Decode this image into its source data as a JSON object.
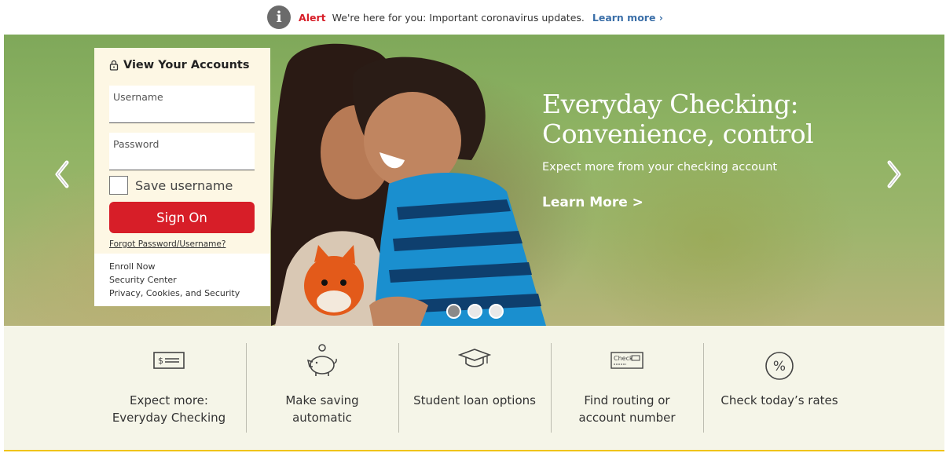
{
  "alert": {
    "icon": "info-icon",
    "label": "Alert",
    "text": "We're here for you: Important coronavirus updates.",
    "link": "Learn more"
  },
  "login": {
    "title": "View Your Accounts",
    "username_placeholder": "Username",
    "password_placeholder": "Password",
    "save_username": "Save username",
    "sign_on": "Sign On",
    "forgot": "Forgot Password/Username?",
    "links": [
      "Enroll Now",
      "Security Center",
      "Privacy, Cookies, and Security"
    ]
  },
  "hero": {
    "title_line1": "Everyday Checking:",
    "title_line2": "Convenience, control",
    "subtitle": "Expect more from your checking account",
    "cta": "Learn More >",
    "slides": {
      "count": 3,
      "active": 1
    }
  },
  "features": [
    {
      "icon": "check-bill-icon",
      "line1": "Expect more:",
      "line2": "Everyday Checking"
    },
    {
      "icon": "piggy-bank-icon",
      "line1": "Make saving",
      "line2": "automatic"
    },
    {
      "icon": "graduation-cap-icon",
      "line1": "Student loan options",
      "line2": ""
    },
    {
      "icon": "check-routing-icon",
      "line1": "Find routing or",
      "line2": "account number"
    },
    {
      "icon": "percent-icon",
      "line1": "Check today’s rates",
      "line2": ""
    }
  ],
  "colors": {
    "brand_red": "#d71e28",
    "link_blue": "#3b6fa8",
    "accent_gold": "#f0c419"
  }
}
